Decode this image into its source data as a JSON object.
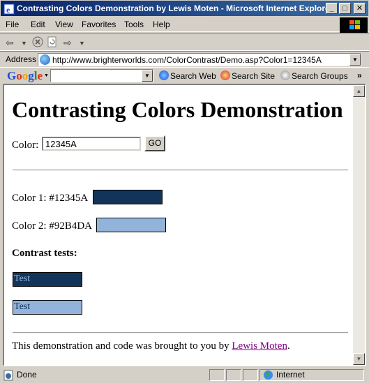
{
  "window": {
    "title": "Contrasting Colors Demonstration by Lewis Moten - Microsoft Internet Explorer",
    "buttons": {
      "minimize": "_",
      "maximize": "□",
      "close": "✕"
    }
  },
  "menubar": {
    "items": [
      "File",
      "Edit",
      "View",
      "Favorites",
      "Tools",
      "Help"
    ]
  },
  "toolbar": {
    "icons": [
      "back-icon",
      "dropdown-icon",
      "stop-icon",
      "refresh-icon",
      "forward-icon"
    ]
  },
  "address": {
    "label": "Address",
    "url": "http://www.brighterworlds.com/ColorContrast/Demo.asp?Color1=12345A"
  },
  "google_toolbar": {
    "logo": [
      "G",
      "o",
      "o",
      "g",
      "l",
      "e"
    ],
    "search_value": "",
    "buttons": [
      "Search Web",
      "Search Site",
      "Search Groups"
    ],
    "more": "»"
  },
  "page": {
    "heading": "Contrasting Colors Demonstration",
    "color_label": "Color:",
    "color_value": "12345A",
    "go_label": "GO",
    "color1_label": "Color 1: #12345A",
    "color1_hex": "#12345A",
    "color2_label": "Color 2: #92B4DA",
    "color2_hex": "#92B4DA",
    "tests_heading": "Contrast tests:",
    "test1_text": "Test",
    "test2_text": "Test",
    "footer_text": "This demonstration and code was brought to you by ",
    "footer_link": "Lewis Moten",
    "footer_end": "."
  },
  "status": {
    "text": "Done",
    "zone": "Internet"
  },
  "colors": {
    "titlebar": "#0a246a",
    "color1": "#12345A",
    "color2": "#92B4DA",
    "link_visited": "#800080"
  }
}
